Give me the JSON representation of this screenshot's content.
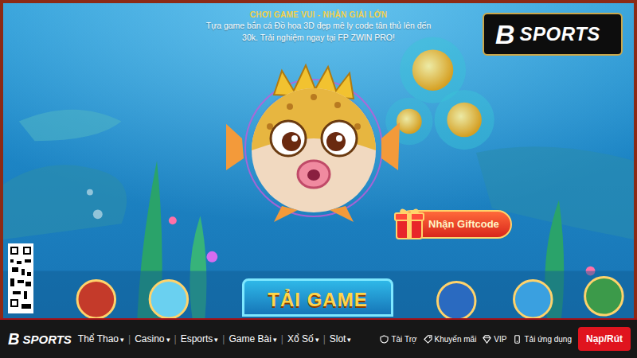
{
  "banner": {
    "heading": "CHƠI GAME VUI - NHẬN GIẢI LỚN",
    "description": "Tựa game bắn cá Đồ họa 3D đẹp mê ly code tân thủ lên đến 30k. Trải nghiệm ngay tại FP ZWIN PRO!",
    "giftcode_button": "Nhận Giftcode",
    "download_button": "TẢI GAME"
  },
  "badge_logo": {
    "mark": "B",
    "text": "SPORTS"
  },
  "navbar": {
    "logo": {
      "mark": "B",
      "text": "SPORTS"
    },
    "separator": "|",
    "menu": [
      {
        "label": "Thể Thao",
        "caret": "▾"
      },
      {
        "label": "Casino",
        "caret": "▾"
      },
      {
        "label": "Esports",
        "caret": "▾"
      },
      {
        "label": "Game Bài",
        "caret": "▾"
      },
      {
        "label": "Xổ Số",
        "caret": "▾"
      },
      {
        "label": "Slot",
        "caret": "▾"
      }
    ],
    "links": [
      {
        "label": "Tài Trợ",
        "kind": "sponsor"
      },
      {
        "label": "Khuyến mãi",
        "kind": "promo"
      },
      {
        "label": "VIP",
        "kind": "vip"
      },
      {
        "label": "Tải ứng dụng",
        "kind": "app"
      }
    ],
    "cta": "Nạp/Rút"
  }
}
